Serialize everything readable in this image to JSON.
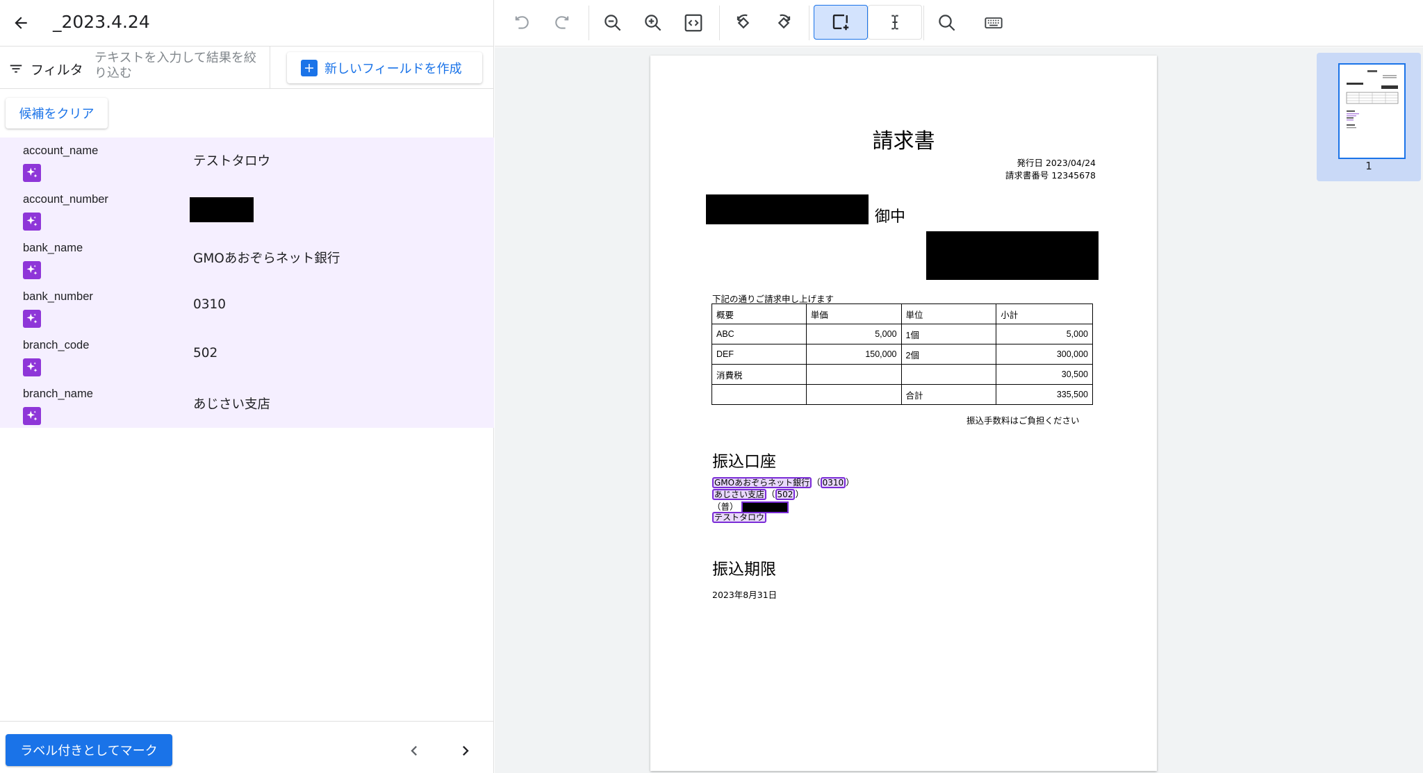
{
  "header": {
    "title": "_2023.4.24"
  },
  "filter": {
    "label": "フィルタ",
    "placeholder": "テキストを入力して結果を絞り込む",
    "new_field_label": "新しいフィールドを作成"
  },
  "clear_label": "候補をクリア",
  "fields": [
    {
      "name": "account_name",
      "value": "テストタロウ"
    },
    {
      "name": "account_number",
      "value": ""
    },
    {
      "name": "bank_name",
      "value": "GMOあおぞらネット銀行"
    },
    {
      "name": "bank_number",
      "value": "0310"
    },
    {
      "name": "branch_code",
      "value": "502"
    },
    {
      "name": "branch_name",
      "value": "あじさい支店"
    }
  ],
  "footer": {
    "mark_label": "ラベル付きとしてマーク"
  },
  "toolbar": {
    "icons": [
      "undo-icon",
      "redo-icon",
      "zoom-out-icon",
      "zoom-in-icon",
      "fit-page-icon",
      "rotate-left-icon",
      "rotate-right-icon",
      "add-region-icon",
      "text-cursor-icon",
      "search-icon",
      "keyboard-icon"
    ]
  },
  "document": {
    "title": "請求書",
    "issue_date": "発行日 2023/04/24",
    "invoice_number": "請求書番号 12345678",
    "onchu": "御中",
    "intro": "下記の通りご請求申し上げます",
    "table": {
      "headers": [
        "概要",
        "単価",
        "単位",
        "小計"
      ],
      "rows": [
        [
          "ABC",
          "5,000",
          "1個",
          "5,000"
        ],
        [
          "DEF",
          "150,000",
          "2個",
          "300,000"
        ],
        [
          "消費税",
          "",
          "",
          "30,500"
        ],
        [
          "",
          "",
          "合計",
          "335,500"
        ]
      ]
    },
    "fee_note": "振込手数料はご負担ください",
    "account_section_title": "振込口座",
    "account_lines": {
      "bank": "GMOあおぞらネット銀行",
      "bank_code": "0310",
      "branch": "あじさい支店",
      "branch_code": "502",
      "type": "（普）",
      "holder": "テストタロウ"
    },
    "deadline_title": "振込期限",
    "deadline": "2023年8月31日"
  },
  "thumbnail": {
    "page_number": "1"
  }
}
